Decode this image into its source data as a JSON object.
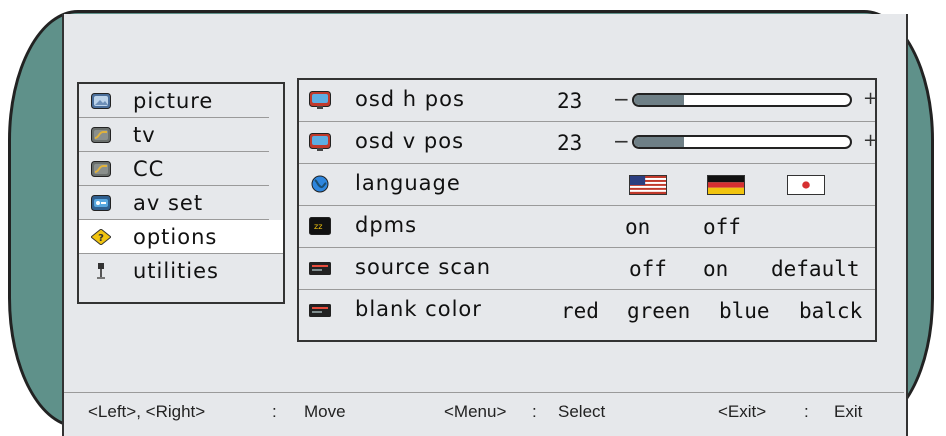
{
  "menu": {
    "items": [
      {
        "label": "picture",
        "icon": "picture-icon"
      },
      {
        "label": "tv",
        "icon": "tv-icon"
      },
      {
        "label": "CC",
        "icon": "cc-icon"
      },
      {
        "label": "av set",
        "icon": "av-set-icon"
      },
      {
        "label": "options",
        "icon": "options-icon",
        "selected": true
      },
      {
        "label": "utilities",
        "icon": "utilities-icon"
      }
    ]
  },
  "options": {
    "osd_h_pos": {
      "label": "osd h pos",
      "value": "23",
      "minus": "−",
      "plus": "+",
      "level": 0.23
    },
    "osd_v_pos": {
      "label": "osd v pos",
      "value": "23",
      "minus": "−",
      "plus": "+",
      "level": 0.23
    },
    "language": {
      "label": "language",
      "flags": [
        "us-flag",
        "german-flag",
        "japan-flag"
      ]
    },
    "dpms": {
      "label": "dpms",
      "choices": [
        "on",
        "off"
      ]
    },
    "source_scan": {
      "label": "source scan",
      "choices": [
        "off",
        "on",
        "default"
      ]
    },
    "blank_color": {
      "label": "blank color",
      "choices": [
        "red",
        "green",
        "blue",
        "balck"
      ]
    }
  },
  "footer": {
    "move_keys": "<Left>, <Right>",
    "move_sep": ":",
    "move_label": "Move",
    "select_key": "<Menu>",
    "select_sep": ":",
    "select_label": "Select",
    "exit_key": "<Exit>",
    "exit_sep": ":",
    "exit_label": "Exit"
  },
  "colors": {
    "frame": "#5f918a",
    "panel": "#e6e8eb",
    "selected_row": "#ffffff",
    "slider_fill": "#6e7f86"
  }
}
